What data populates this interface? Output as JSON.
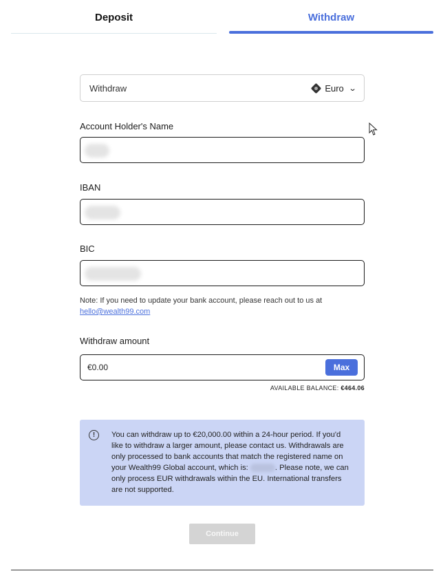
{
  "tabs": [
    {
      "label": "Deposit",
      "active": false
    },
    {
      "label": "Withdraw",
      "active": true
    }
  ],
  "method_select": {
    "label": "Withdraw",
    "currency": "Euro"
  },
  "fields": {
    "account_holder": {
      "label": "Account Holder's Name",
      "value": ""
    },
    "iban": {
      "label": "IBAN",
      "value": ""
    },
    "bic": {
      "label": "BIC",
      "value": ""
    }
  },
  "note": {
    "text": "Note: If you need to update your bank account, please reach out to us at",
    "email": "hello@wealth99.com"
  },
  "amount": {
    "label": "Withdraw amount",
    "value": "€0.00",
    "max_label": "Max",
    "balance_label": "AVAILABLE BALANCE:",
    "balance_value": "€464.06"
  },
  "info": {
    "text_1": "You can withdraw up to €20,000.00 within a 24-hour period. If you'd like to withdraw a larger amount, please contact us. Withdrawals are only processed to bank accounts that match the registered name on your Wealth99 Global account, which is:",
    "text_2": ". Please note, we can only process EUR withdrawals within the EU. International transfers are not supported.",
    "icon_glyph": "!"
  },
  "continue_label": "Continue",
  "colors": {
    "accent": "#4a6fdc",
    "info_bg": "#cbd5f5",
    "disabled": "#d4d4d4"
  }
}
